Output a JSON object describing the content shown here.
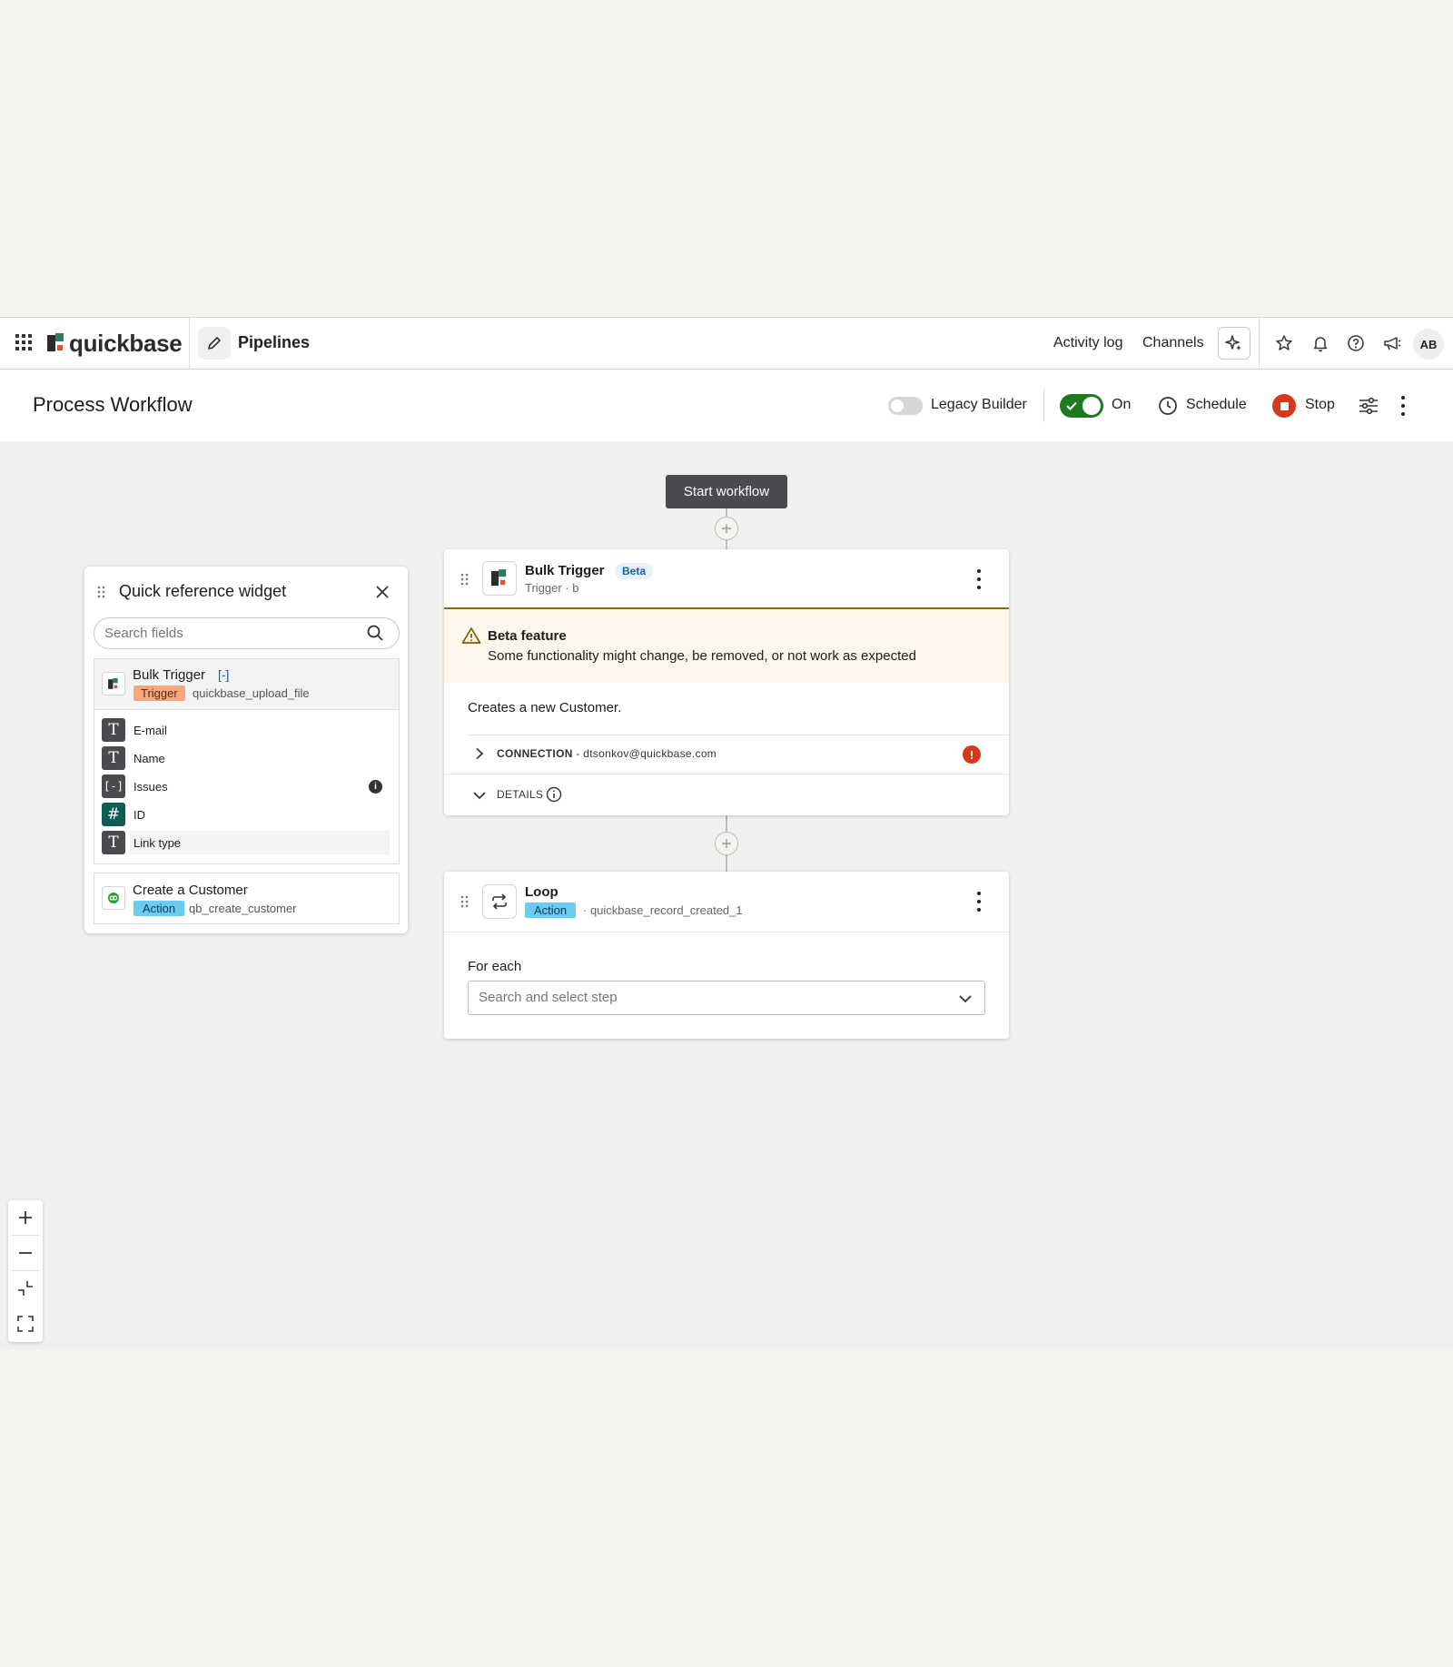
{
  "nav": {
    "brand": "quickbase",
    "section": "Pipelines",
    "links": [
      "Activity log",
      "Channels"
    ],
    "avatar": "AB",
    "icons": [
      "apps-grid-icon",
      "pencil-icon",
      "ai-sparkle-icon",
      "star-icon",
      "bell-icon",
      "help-icon",
      "megaphone-icon"
    ]
  },
  "header": {
    "title": "Process Workflow",
    "legacy_label": "Legacy Builder",
    "legacy_enabled": false,
    "status_label": "On",
    "status_enabled": true,
    "schedule_label": "Schedule",
    "stop_label": "Stop"
  },
  "canvas": {
    "start_label": "Start workflow",
    "trigger_step": {
      "title": "Bulk Trigger",
      "badge": "Beta",
      "subtitle": "Trigger · b",
      "banner_title": "Beta feature",
      "banner_text": "Some functionality might change, be removed, or not work as expected",
      "description": "Creates a new Customer.",
      "connection_label": "CONNECTION",
      "connection_value": " - dtsonkov@quickbase.com",
      "details_label": "DETAILS"
    },
    "loop_step": {
      "title": "Loop",
      "badge": "Action",
      "subtitle": "· quickbase_record_created_1",
      "for_each_label": "For each",
      "select_placeholder": "Search and select step"
    }
  },
  "widget": {
    "title": "Quick reference widget",
    "search_placeholder": "Search fields",
    "trigger": {
      "title": "Bulk Trigger",
      "list_marker": "[-]",
      "badge": "Trigger",
      "id": "quickbase_upload_file"
    },
    "fields": [
      {
        "icon": "T",
        "label": "E-mail"
      },
      {
        "icon": "T",
        "label": "Name"
      },
      {
        "icon": "[-]",
        "label": "Issues"
      },
      {
        "icon": "#",
        "label": "ID"
      },
      {
        "icon": "T",
        "label": "Link type"
      }
    ],
    "action": {
      "title": "Create a Customer",
      "badge": "Action",
      "id": "qb_create_customer"
    }
  },
  "colors": {
    "toggle_on": "#1f7a1f",
    "stop": "#d5381a",
    "error": "#d5381a",
    "action_badge": "#6ccbf0",
    "trigger_badge": "#f7a77d",
    "beta_banner": "#fdf6ea",
    "id_field_icon": "#0d5c55"
  }
}
